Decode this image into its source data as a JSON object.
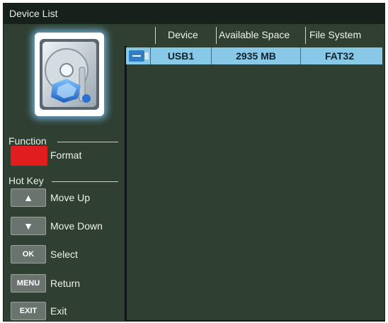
{
  "title": "Device List",
  "function": {
    "label": "Function",
    "format_label": "Format",
    "red_color": "#e11c1c"
  },
  "hotkeys": {
    "label": "Hot Key",
    "items": [
      {
        "key": "▲",
        "label": "Move Up"
      },
      {
        "key": "▼",
        "label": "Move Down"
      },
      {
        "key": "OK",
        "label": "Select"
      },
      {
        "key": "MENU",
        "label": "Return"
      },
      {
        "key": "EXIT",
        "label": "Exit"
      }
    ]
  },
  "table": {
    "columns": [
      "Device",
      "Available Space",
      "File System"
    ],
    "rows": [
      {
        "icon": "usb-icon",
        "device": "USB1",
        "space": "2935 MB",
        "fs": "FAT32"
      }
    ],
    "selected_color": "#88c9e8"
  },
  "image": {
    "name": "hard-disk-drive-illustration"
  }
}
